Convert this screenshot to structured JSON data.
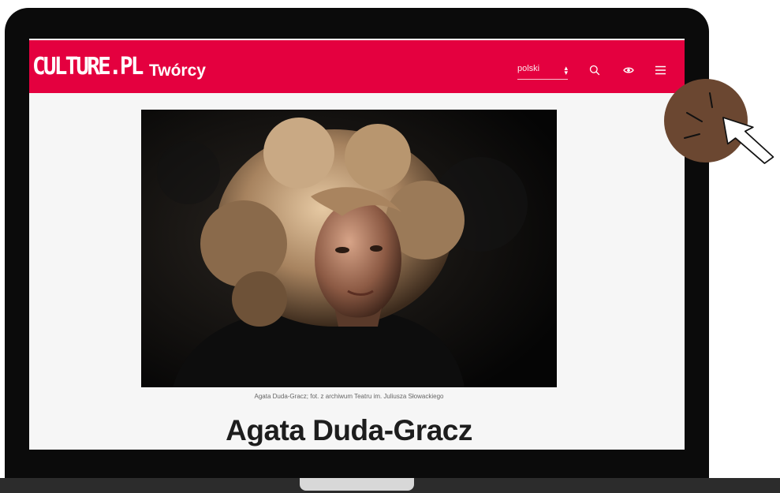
{
  "header": {
    "logo_text": "CULTURE.PL",
    "section_title": "Twórcy",
    "language": {
      "selected": "polski"
    },
    "icons": [
      "search-icon",
      "accessibility-eye-icon",
      "hamburger-menu-icon"
    ]
  },
  "article": {
    "photo_caption": "Agata Duda-Gracz; fot. z archiwum Teatru im. Juliusza Słowackiego",
    "headline": "Agata Duda-Gracz"
  },
  "colors": {
    "brand": "#e4003f",
    "page_background": "#f6f6f6",
    "headline": "#1d1d1d",
    "click_badge": "#6b4731"
  }
}
